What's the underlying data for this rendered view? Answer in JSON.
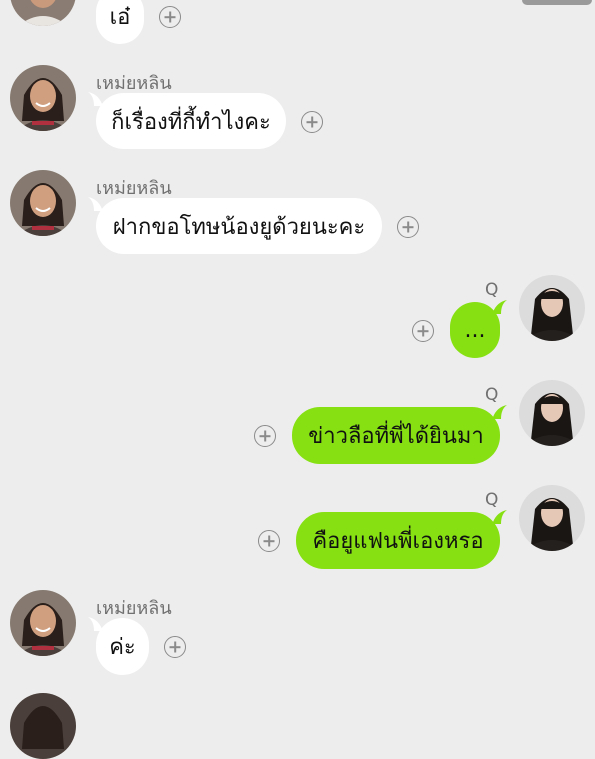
{
  "conversation": {
    "messages": [
      {
        "side": "in",
        "sender": "",
        "text": "เอ๋"
      },
      {
        "side": "in",
        "sender": "เหม่ยหลิน",
        "text": "ก็เรื่องที่กี้ทำไงคะ"
      },
      {
        "side": "in",
        "sender": "เหม่ยหลิน",
        "text": "ฝากขอโทษน้องยูด้วยนะคะ"
      },
      {
        "side": "out",
        "sender": "Q",
        "text": "..."
      },
      {
        "side": "out",
        "sender": "Q",
        "text": "ข่าวลือที่พี่ได้ยินมา"
      },
      {
        "side": "out",
        "sender": "Q",
        "text": "คือยูแฟนพี่เองหรอ"
      },
      {
        "side": "in",
        "sender": "เหม่ยหลิน",
        "text": "ค่ะ"
      }
    ]
  },
  "colors": {
    "background": "#ededed",
    "incoming_bubble": "#ffffff",
    "outgoing_bubble": "#86e012",
    "name_text": "#707070"
  }
}
